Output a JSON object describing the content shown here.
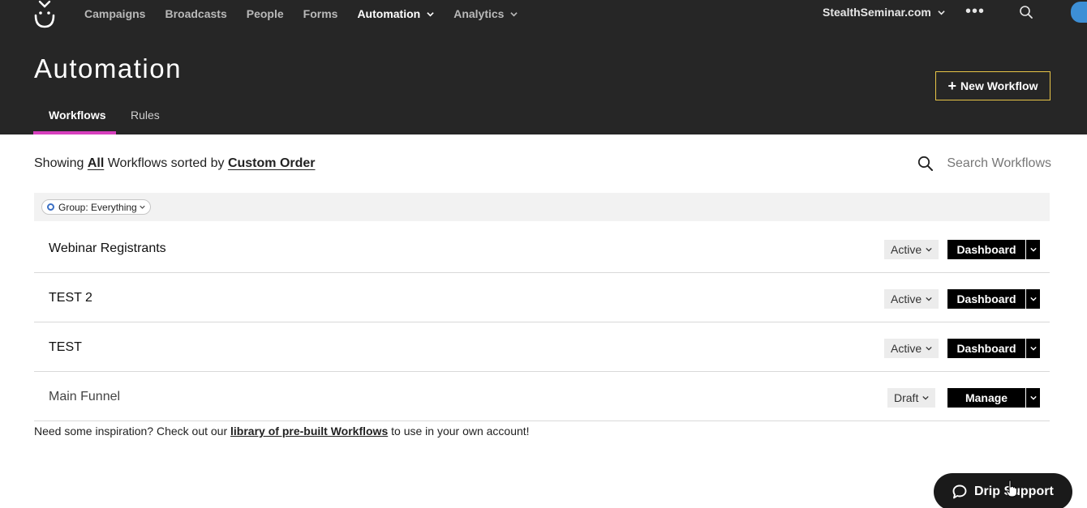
{
  "nav": {
    "items": [
      {
        "label": "Campaigns",
        "active": false,
        "dropdown": false
      },
      {
        "label": "Broadcasts",
        "active": false,
        "dropdown": false
      },
      {
        "label": "People",
        "active": false,
        "dropdown": false
      },
      {
        "label": "Forms",
        "active": false,
        "dropdown": false
      },
      {
        "label": "Automation",
        "active": true,
        "dropdown": true
      },
      {
        "label": "Analytics",
        "active": false,
        "dropdown": true
      }
    ],
    "account": "StealthSeminar.com",
    "more": "•••",
    "icons": {
      "logo": "drip-smile-logo",
      "search": "search-icon",
      "announcements": "megaphone-icon"
    }
  },
  "header": {
    "title": "Automation",
    "new_button": "New Workflow",
    "tabs": [
      {
        "label": "Workflows",
        "active": true
      },
      {
        "label": "Rules",
        "active": false
      }
    ]
  },
  "list": {
    "summary_prefix": "Showing",
    "summary_filter": "All",
    "summary_middle": "Workflows sorted by",
    "summary_sort": "Custom Order",
    "search_placeholder": "Search Workflows",
    "group_filter": "Group: Everything",
    "rows": [
      {
        "name": "Webinar Registrants",
        "status": "Active",
        "action": "Dashboard"
      },
      {
        "name": "TEST 2",
        "status": "Active",
        "action": "Dashboard"
      },
      {
        "name": "TEST",
        "status": "Active",
        "action": "Dashboard"
      },
      {
        "name": "Main Funnel",
        "status": "Draft",
        "action": "Manage"
      }
    ]
  },
  "footer": {
    "inspiration_prefix": "Need some inspiration? Check out our",
    "inspiration_link": "library of pre-built Workflows",
    "inspiration_suffix": "to use in your own account!",
    "support_label": "Drip Support"
  },
  "colors": {
    "topbar": "#262626",
    "tab_accent": "#d63fbd",
    "button_border": "#e8c547",
    "pill_dot": "#3a6fc4"
  }
}
